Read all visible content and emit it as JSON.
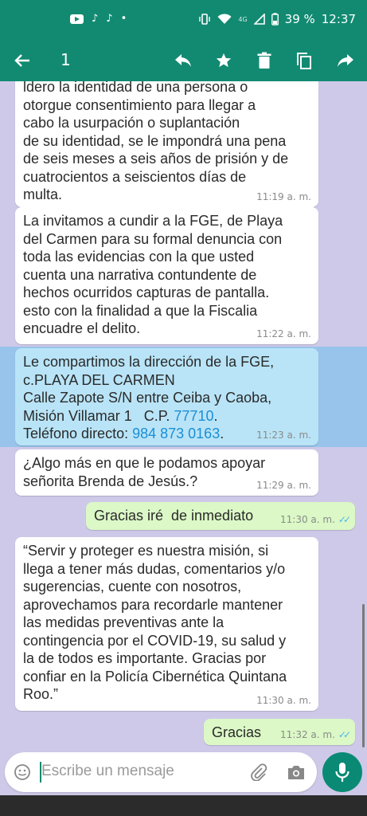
{
  "status_bar": {
    "net": "4G",
    "battery": "39 %",
    "time": "12:37"
  },
  "action_bar": {
    "selected_count": "1"
  },
  "messages": [
    {
      "dir": "in",
      "text": "ldero la identidad de una persona o\notorgue consentimiento para llegar a\ncabo la usurpación o suplantación\nde su identidad, se le impondrá una pena\nde seis meses a seis años de prisión y de\ncuatrocientos a seiscientos días de\nmulta.",
      "time": "11:19 a. m."
    },
    {
      "dir": "in",
      "text": "La invitamos a cundir a la FGE, de Playa\ndel Carmen para su formal denuncia con\ntoda las evidencias con la que usted\ncuenta una narrativa contundente de\nhechos ocurridos capturas de pantalla.\nesto con la finalidad a que la Fiscalia\nencuadre el delito.",
      "time": "11:22 a. m."
    },
    {
      "dir": "in",
      "selected": true,
      "line1": "Le compartimos la dirección de la FGE,",
      "line2": "c.PLAYA DEL CARMEN",
      "line3": "Calle Zapote S/N entre Ceiba y Caoba,",
      "line4_prefix": "Misión Villamar 1   C.P. ",
      "postal_code": "77710",
      "line4_suffix": ".",
      "line5_prefix": "Teléfono directo: ",
      "phone": "984 873 0163",
      "line5_suffix": ".",
      "time": "11:23 a. m."
    },
    {
      "dir": "in",
      "text": "¿Algo más en que le podamos apoyar\nseñorita Brenda de Jesús.?",
      "time": "11:29 a. m."
    },
    {
      "dir": "out",
      "text": "Gracias iré  de inmediato",
      "time": "11:30 a. m."
    },
    {
      "dir": "in",
      "text": "“Servir y proteger es nuestra misión, si\nllega a tener más dudas, comentarios y/o\nsugerencias, cuente con nosotros,\naprovechamos para recordarle mantener\nlas medidas preventivas ante la\ncontingencia por el COVID-19, su salud y\nla de todos es importante. Gracias por\nconfiar en la Policía Cibernética Quintana\nRoo.”",
      "time": "11:30 a. m."
    },
    {
      "dir": "out",
      "text": "Gracias",
      "time": "11:32 a. m."
    }
  ],
  "composer": {
    "placeholder": "Escribe un mensaje"
  },
  "colors": {
    "header": "#128a72",
    "chat_bg": "#cec9e8",
    "outgoing": "#dbf8c6",
    "link": "#1a8fd6",
    "read_ticks": "#4fb6ec"
  }
}
